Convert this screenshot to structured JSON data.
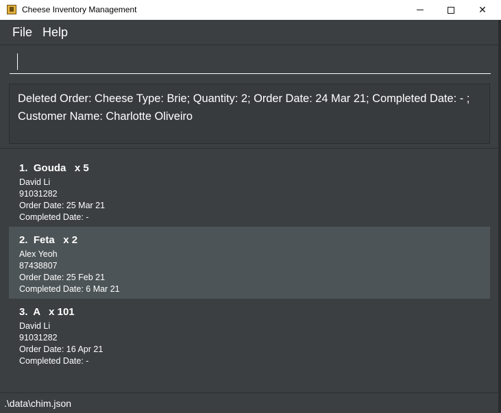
{
  "window": {
    "title": "Cheese Inventory Management"
  },
  "menu": {
    "file": "File",
    "help": "Help"
  },
  "command": {
    "value": "",
    "placeholder": ""
  },
  "result": {
    "message": "Deleted Order: Cheese Type: Brie; Quantity: 2; Order Date: 24 Mar 21; Completed Date: - ; Customer Name: Charlotte Oliveiro"
  },
  "orders": [
    {
      "index": "1.",
      "cheese": "Gouda",
      "quantity": "x 5",
      "customer": "David Li",
      "phone": "91031282",
      "order_date": "Order Date: 25 Mar 21",
      "completed_date": "Completed Date: -",
      "selected": false
    },
    {
      "index": "2.",
      "cheese": "Feta",
      "quantity": "x 2",
      "customer": "Alex Yeoh",
      "phone": "87438807",
      "order_date": "Order Date: 25 Feb 21",
      "completed_date": "Completed Date: 6 Mar 21",
      "selected": true
    },
    {
      "index": "3.",
      "cheese": "A",
      "quantity": "x 101",
      "customer": "David Li",
      "phone": "91031282",
      "order_date": "Order Date: 16 Apr 21",
      "completed_date": "Completed Date: -",
      "selected": false
    }
  ],
  "status": {
    "path": ".\\data\\chim.json"
  },
  "colors": {
    "background": "#3b3f42",
    "selected_row": "#4d5457",
    "text": "#ffffff"
  }
}
